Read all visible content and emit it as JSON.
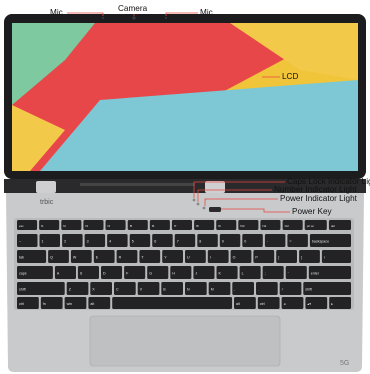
{
  "callouts": {
    "mic_left": "Mic",
    "camera": "Camera",
    "mic_right": "Mic",
    "lcd": "LCD",
    "caps_lock": "Caps Lock Indicator Light",
    "number": "Number Indicator Light",
    "power_indicator": "Power Indicator Light",
    "power_key": "Power Key"
  },
  "brand": "trbic",
  "badge": "5G",
  "screen_colors": {
    "background": "#f0c53a",
    "red": "#e8474a",
    "teal": "#7dc8d4",
    "green": "#7fc9a1",
    "yellow_light": "#f3c94a"
  },
  "keyboard": {
    "row1": [
      "esc",
      "f1",
      "f2",
      "f3",
      "f4",
      "f5",
      "f6",
      "f7",
      "f8",
      "f9",
      "f10",
      "f11",
      "f12",
      "prt sc",
      "del"
    ],
    "row2": [
      "~",
      "1",
      "2",
      "3",
      "4",
      "5",
      "6",
      "7",
      "8",
      "9",
      "0",
      "-",
      "=",
      "backspace"
    ],
    "row3": [
      "tab",
      "Q",
      "W",
      "E",
      "R",
      "T",
      "Y",
      "U",
      "I",
      "O",
      "P",
      "[",
      "]",
      "\\"
    ],
    "row4": [
      "caps",
      "A",
      "S",
      "D",
      "F",
      "G",
      "H",
      "J",
      "K",
      "L",
      ";",
      "'",
      "enter"
    ],
    "row5": [
      "shift",
      "Z",
      "X",
      "C",
      "V",
      "B",
      "N",
      "M",
      ",",
      ".",
      "/",
      "shift"
    ],
    "row6": [
      "ctrl",
      "fn",
      "win",
      "alt",
      "",
      "alt",
      "ctrl",
      "◂",
      "▴▾",
      "▸"
    ]
  }
}
